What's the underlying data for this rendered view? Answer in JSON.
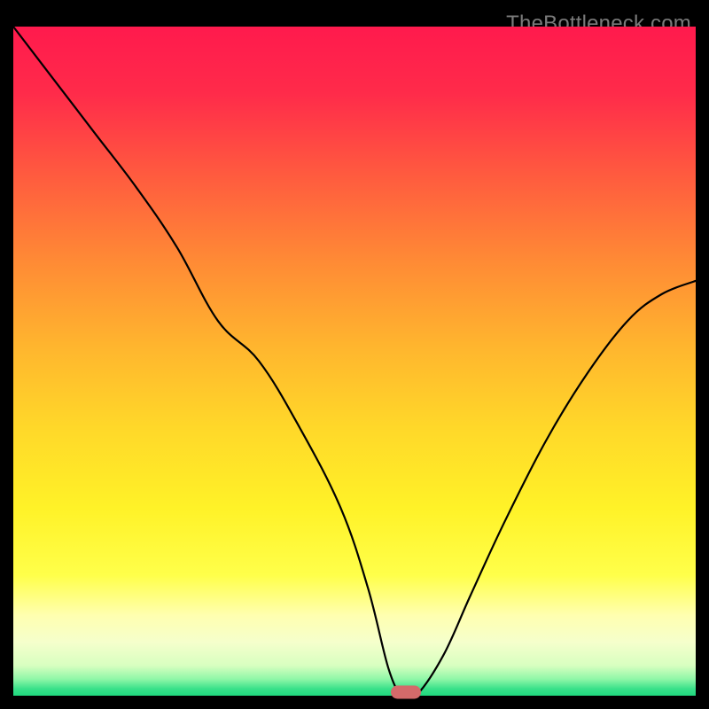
{
  "watermark": "TheBottleneck.com",
  "gradient": {
    "stops": [
      {
        "offset": 0.0,
        "color": "#ff1a4d"
      },
      {
        "offset": 0.1,
        "color": "#ff2b4a"
      },
      {
        "offset": 0.22,
        "color": "#ff5a3f"
      },
      {
        "offset": 0.35,
        "color": "#ff8a35"
      },
      {
        "offset": 0.48,
        "color": "#ffb62e"
      },
      {
        "offset": 0.6,
        "color": "#ffd829"
      },
      {
        "offset": 0.72,
        "color": "#fff228"
      },
      {
        "offset": 0.82,
        "color": "#ffff4a"
      },
      {
        "offset": 0.88,
        "color": "#ffffb0"
      },
      {
        "offset": 0.92,
        "color": "#f5ffcc"
      },
      {
        "offset": 0.955,
        "color": "#d8ffc0"
      },
      {
        "offset": 0.975,
        "color": "#90f7a8"
      },
      {
        "offset": 0.99,
        "color": "#38e089"
      },
      {
        "offset": 1.0,
        "color": "#1fd97e"
      }
    ]
  },
  "chart_data": {
    "type": "line",
    "title": "",
    "xlabel": "",
    "ylabel": "",
    "xlim": [
      0,
      100
    ],
    "ylim": [
      0,
      100
    ],
    "series": [
      {
        "name": "bottleneck-curve",
        "x": [
          0,
          6,
          12,
          18,
          24,
          30,
          36,
          42,
          48,
          52,
          55,
          57,
          59,
          63,
          67,
          72,
          78,
          84,
          90,
          95,
          100
        ],
        "y_pct": [
          100,
          92,
          84,
          76,
          67,
          56,
          50,
          40,
          28,
          16,
          4,
          0,
          0,
          6,
          15,
          26,
          38,
          48,
          56,
          60,
          62
        ]
      }
    ],
    "marker": {
      "x": 57.5,
      "y_pct": 0
    },
    "flat_segment": {
      "x_start": 54.5,
      "x_end": 59
    }
  }
}
